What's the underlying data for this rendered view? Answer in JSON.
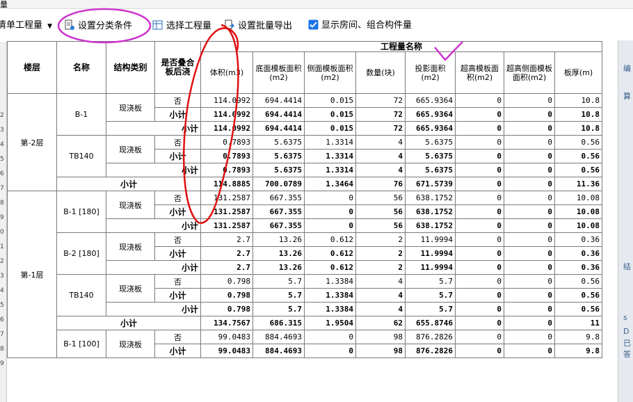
{
  "window": {
    "top_label": "量"
  },
  "toolbar": {
    "dropdown_label": "清单工程量",
    "set_category_label": "设置分类条件",
    "select_project_label": "选择工程量",
    "batch_export_label": "设置批量导出",
    "show_rooms_label": "显示房间、组合构件量",
    "show_rooms_checked": true
  },
  "table": {
    "headers": {
      "floor": "楼层",
      "name": "名称",
      "struct_type": "结构类别",
      "is_laminated": "是否叠合板后浇",
      "group": "工程量名称",
      "cols": [
        "体积(m3)",
        "底面模板面积(m2)",
        "侧面模板面积(m2)",
        "数量(块)",
        "投影面积(m2)",
        "超高模板面积(m2)",
        "超高侧面模板面积(m2)",
        "板厚(m)"
      ]
    },
    "subtotal_label": "小计",
    "rows": [
      {
        "kind": "data",
        "floor": "第-2层",
        "name": "B-1",
        "stype": "现浇板",
        "flag": "否",
        "v": [
          "114.0992",
          "694.4414",
          "0.015",
          "72",
          "665.9364",
          "0",
          "0",
          "10.8"
        ]
      },
      {
        "kind": "sub3",
        "v": [
          "114.0992",
          "694.4414",
          "0.015",
          "72",
          "665.9364",
          "0",
          "0",
          "10.8"
        ]
      },
      {
        "kind": "sub2",
        "v": [
          "114.0992",
          "694.4414",
          "0.015",
          "72",
          "665.9364",
          "0",
          "0",
          "10.8"
        ]
      },
      {
        "kind": "data",
        "name": "TB140",
        "stype": "现浇板",
        "flag": "否",
        "v": [
          "0.7893",
          "5.6375",
          "1.3314",
          "4",
          "5.6375",
          "0",
          "0",
          "0.56"
        ]
      },
      {
        "kind": "sub3",
        "v": [
          "0.7893",
          "5.6375",
          "1.3314",
          "4",
          "5.6375",
          "0",
          "0",
          "0.56"
        ]
      },
      {
        "kind": "sub2",
        "v": [
          "0.7893",
          "5.6375",
          "1.3314",
          "4",
          "5.6375",
          "0",
          "0",
          "0.56"
        ]
      },
      {
        "kind": "sub1",
        "v": [
          "114.8885",
          "700.0789",
          "1.3464",
          "76",
          "671.5739",
          "0",
          "0",
          "11.36"
        ]
      },
      {
        "kind": "data",
        "floor": "第-1层",
        "name": "B-1 [180]",
        "stype": "现浇板",
        "flag": "否",
        "v": [
          "131.2587",
          "667.355",
          "0",
          "56",
          "638.1752",
          "0",
          "0",
          "10.08"
        ]
      },
      {
        "kind": "sub3",
        "v": [
          "131.2587",
          "667.355",
          "0",
          "56",
          "638.1752",
          "0",
          "0",
          "10.08"
        ]
      },
      {
        "kind": "sub2",
        "v": [
          "131.2587",
          "667.355",
          "0",
          "56",
          "638.1752",
          "0",
          "0",
          "10.08"
        ]
      },
      {
        "kind": "data",
        "name": "B-2 [180]",
        "stype": "现浇板",
        "flag": "否",
        "v": [
          "2.7",
          "13.26",
          "0.612",
          "2",
          "11.9994",
          "0",
          "0",
          "0.36"
        ]
      },
      {
        "kind": "sub3",
        "v": [
          "2.7",
          "13.26",
          "0.612",
          "2",
          "11.9994",
          "0",
          "0",
          "0.36"
        ]
      },
      {
        "kind": "sub2",
        "v": [
          "2.7",
          "13.26",
          "0.612",
          "2",
          "11.9994",
          "0",
          "0",
          "0.36"
        ]
      },
      {
        "kind": "data",
        "name": "TB140",
        "stype": "现浇板",
        "flag": "否",
        "v": [
          "0.798",
          "5.7",
          "1.3384",
          "4",
          "5.7",
          "0",
          "0",
          "0.56"
        ]
      },
      {
        "kind": "sub3",
        "v": [
          "0.798",
          "5.7",
          "1.3384",
          "4",
          "5.7",
          "0",
          "0",
          "0.56"
        ]
      },
      {
        "kind": "sub2",
        "v": [
          "0.798",
          "5.7",
          "1.3384",
          "4",
          "5.7",
          "0",
          "0",
          "0.56"
        ]
      },
      {
        "kind": "sub1",
        "v": [
          "134.7567",
          "686.315",
          "1.9504",
          "62",
          "655.8746",
          "0",
          "0",
          "11"
        ]
      },
      {
        "kind": "data",
        "name": "B-1 [100]",
        "stype": "现浇板",
        "flag": "否",
        "v": [
          "99.0483",
          "884.4693",
          "0",
          "98",
          "876.2826",
          "0",
          "0",
          "9.8"
        ]
      },
      {
        "kind": "sub3",
        "v": [
          "99.0483",
          "884.4693",
          "0",
          "98",
          "876.2826",
          "0",
          "0",
          "9.8"
        ]
      }
    ]
  },
  "row_numbers": [
    "",
    "2",
    "3",
    "4",
    "5",
    "6",
    "7",
    "8",
    "9",
    "0",
    "1",
    "2",
    "3",
    "4",
    "5",
    "6",
    "7",
    "8",
    "9"
  ],
  "right_panel_fragments": [
    "编",
    "算",
    "结",
    "s",
    "D",
    "已答"
  ],
  "colors": {
    "annotation": "#e01010",
    "highlight": "#cc33cc",
    "checkbox": "#1a73e8"
  },
  "icons": [
    "category-icon",
    "table-select-icon",
    "export-icon",
    "checkbox-icon",
    "dropdown-arrow-icon"
  ]
}
